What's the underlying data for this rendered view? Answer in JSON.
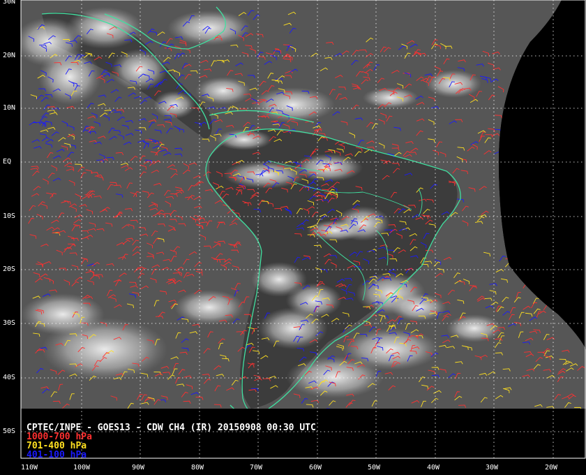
{
  "caption": "CPTEC/INPE - GOES13 - CDW CH4 (IR) 20150908 00:30 UTC",
  "legend": [
    {
      "label": "1000-700 hPa",
      "color": "#ff3030"
    },
    {
      "label": "701-400 hPa",
      "color": "#ffe020"
    },
    {
      "label": "401-100 hPa",
      "color": "#1a1aff"
    }
  ],
  "lat_labels": [
    "30N",
    "20N",
    "10N",
    "EQ",
    "10S",
    "20S",
    "30S",
    "40S",
    "50S"
  ],
  "lon_labels": [
    "110W",
    "100W",
    "90W",
    "80W",
    "70W",
    "60W",
    "50W",
    "40W",
    "30W",
    "20W"
  ],
  "colors": {
    "grid": "#ffffff",
    "coastline": "#40e0a0",
    "cloud": "#e8e8e8",
    "surface": "#4a4a4a"
  },
  "icons": {
    "wind_barb": "wind-barb-icon"
  }
}
